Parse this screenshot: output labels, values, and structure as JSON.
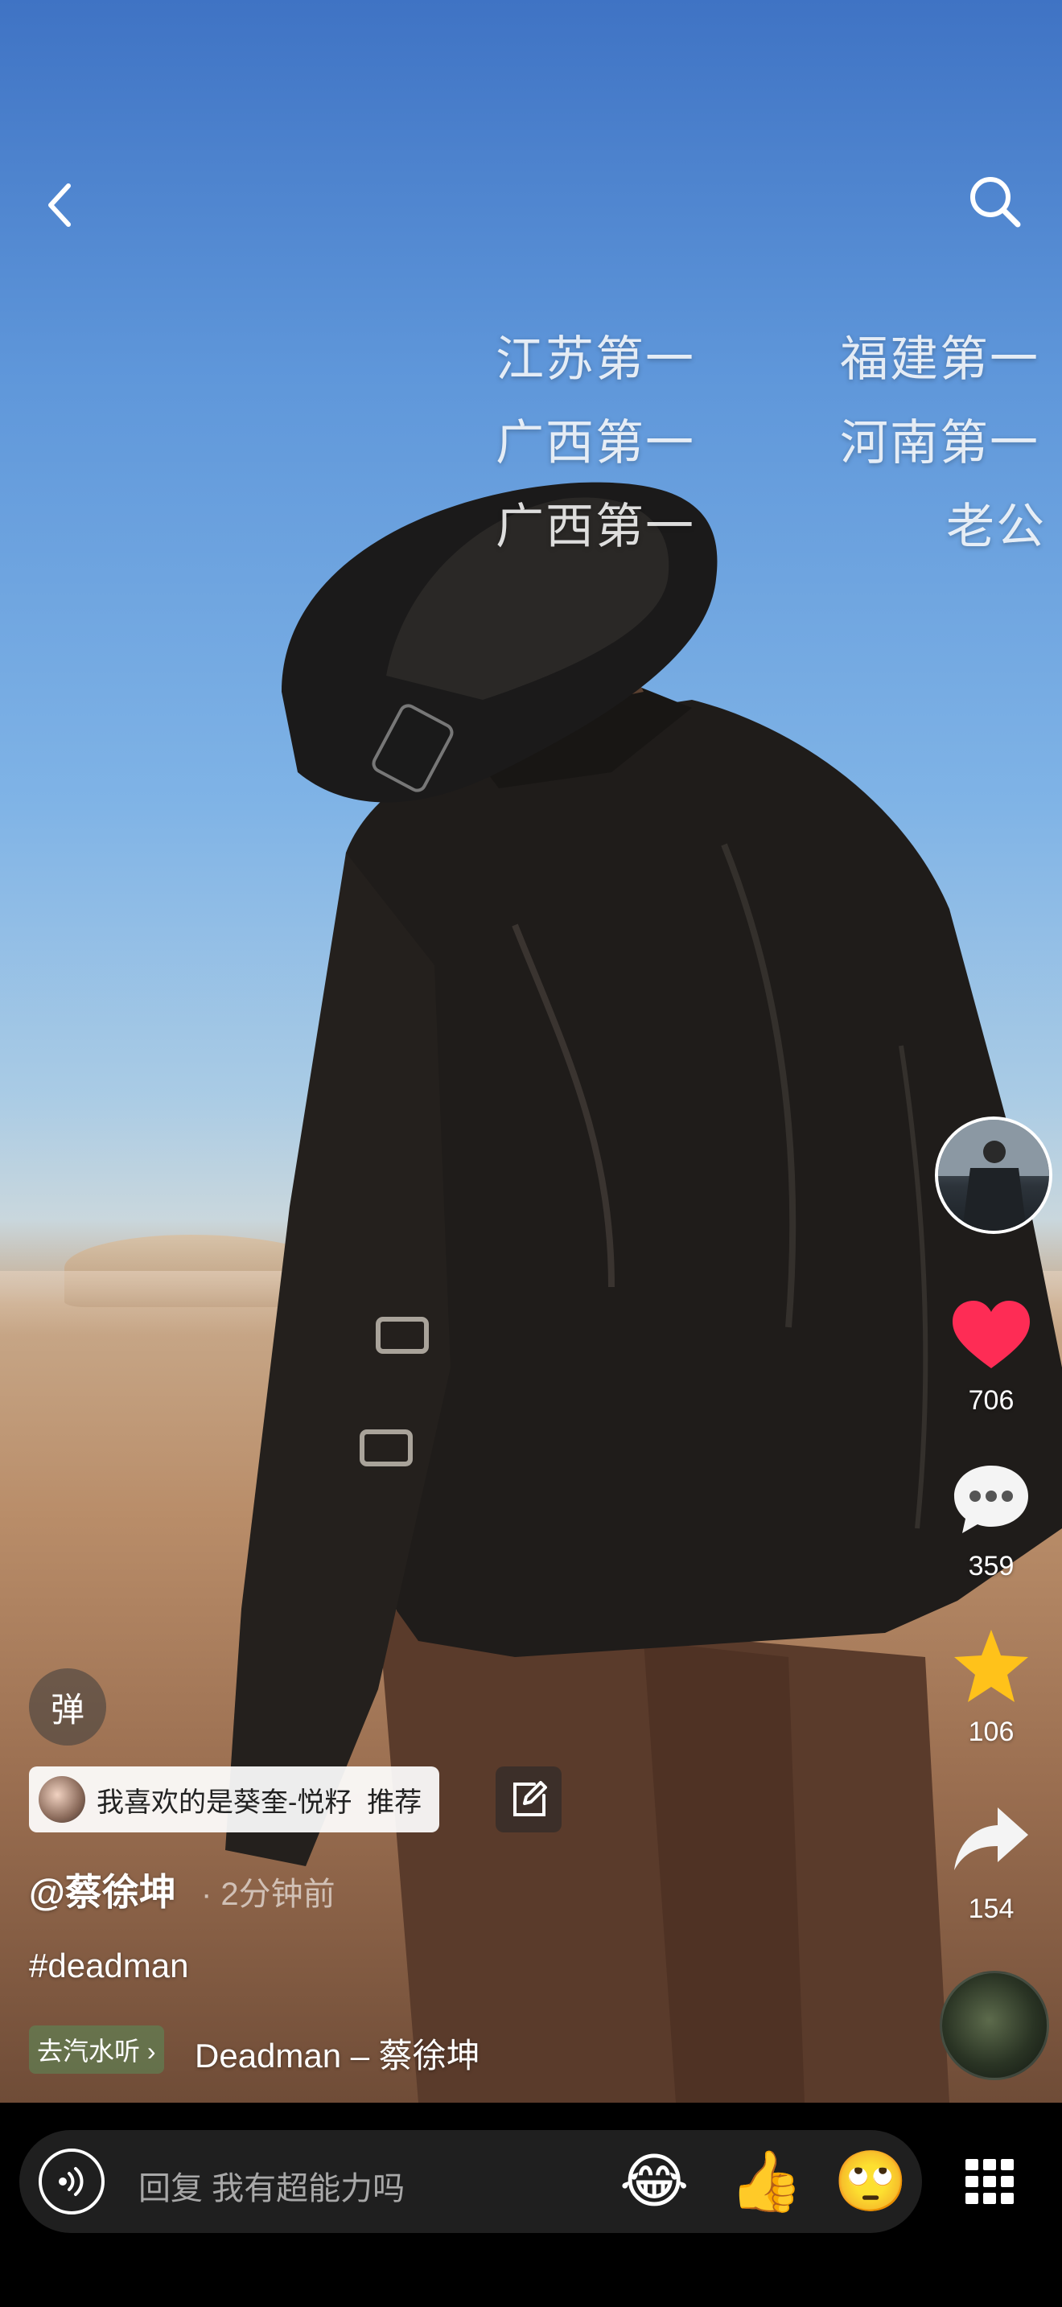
{
  "top_bar": {
    "back_icon": "chevron-left-icon",
    "search_icon": "search-icon"
  },
  "danmaku": [
    "江苏第一",
    "福建第一",
    "广西第一",
    "河南第一",
    "广西第一",
    "老公"
  ],
  "side_actions": {
    "likes": "706",
    "comments": "359",
    "favorites": "106",
    "shares": "154",
    "colors": {
      "like": "#fe2c55",
      "favorite": "#ffc21a"
    }
  },
  "danmaku_toggle_label": "弹",
  "recommendation": {
    "text": "我喜欢的是葵奎-悦籽  推荐",
    "edit_icon": "edit-icon"
  },
  "post": {
    "author": "@蔡徐坤",
    "time": "· 2分钟前",
    "hashtag": "#deadman",
    "music_link": "去汽水听 ›",
    "music_title": "Deadman – 蔡徐坤"
  },
  "reply_bar": {
    "placeholder": "回复 我有超能力吗",
    "emojis": [
      "😂",
      "👍",
      "🙄"
    ],
    "voice_icon": "voice-icon",
    "grid_icon": "grid-icon"
  }
}
